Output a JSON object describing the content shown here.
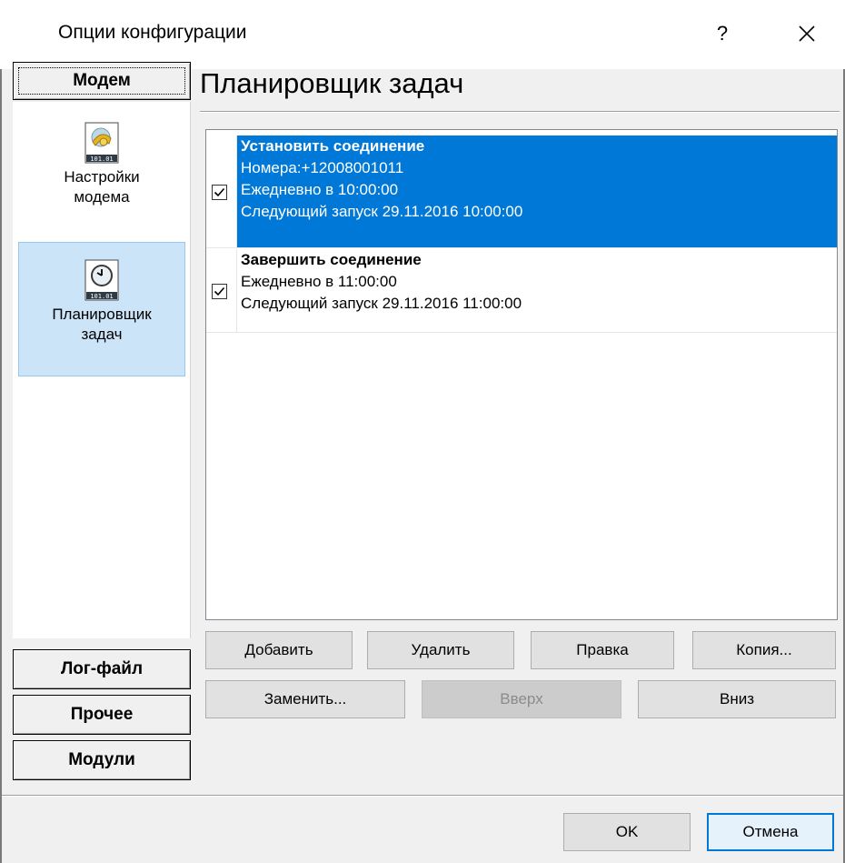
{
  "window": {
    "title": "Опции конфигурации",
    "help_label": "?"
  },
  "sidebar": {
    "active_category": "Модем",
    "items": [
      {
        "label_line1": "Настройки",
        "label_line2": "модема",
        "icon": "modem-settings-icon",
        "selected": false
      },
      {
        "label_line1": "Планировщик",
        "label_line2": "задач",
        "icon": "clock-icon",
        "selected": true
      }
    ],
    "categories": [
      "Лог-файл",
      "Прочее",
      "Модули"
    ]
  },
  "main": {
    "title": "Планировщик задач",
    "tasks": [
      {
        "checked": true,
        "selected": true,
        "title": "Установить соединение",
        "lines": [
          "Номера:+12008001011",
          "Ежедневно в 10:00:00",
          "Следующий запуск 29.11.2016 10:00:00"
        ]
      },
      {
        "checked": true,
        "selected": false,
        "title": "Завершить соединение",
        "lines": [
          "Ежедневно в 11:00:00",
          "Следующий запуск 29.11.2016 11:00:00"
        ]
      }
    ],
    "buttons_row1": [
      "Добавить",
      "Удалить",
      "Правка",
      "Копия..."
    ],
    "buttons_row2": [
      "Заменить...",
      "Вверх",
      "Вниз"
    ]
  },
  "footer": {
    "ok_label": "OK",
    "cancel_label": "Отмена"
  },
  "colors": {
    "selection": "#0078d7",
    "sidebar_selected": "#cce4f7",
    "dialog_bg": "#f0f0f0"
  }
}
